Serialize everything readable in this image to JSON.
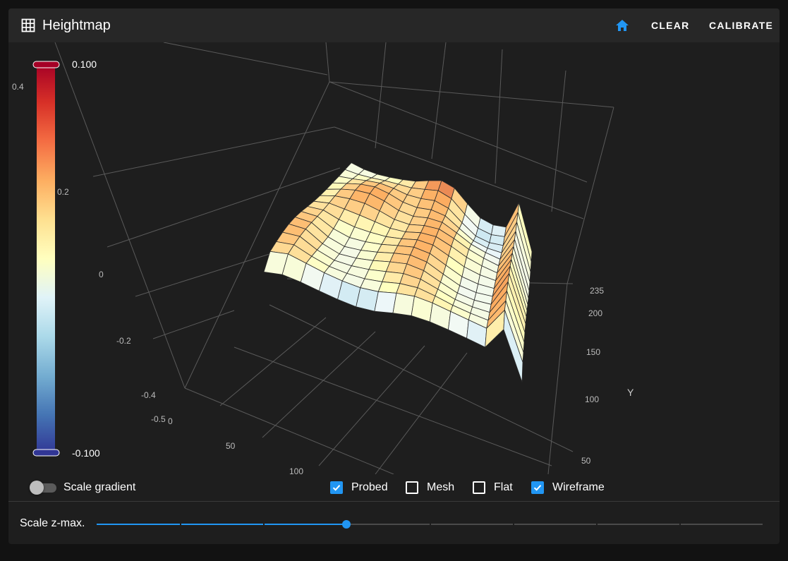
{
  "toolbar": {
    "title": "Heightmap",
    "title_icon": "grid-icon",
    "home_icon": "home-icon",
    "clear_label": "CLEAR",
    "calibrate_label": "CALIBRATE",
    "accent_color": "#2196f3"
  },
  "colorbar": {
    "max_label": "0.100",
    "min_label": "-0.100",
    "tick_labels": [
      "0.4",
      "0.2"
    ],
    "colors": [
      "#a50026",
      "#d73027",
      "#f46d43",
      "#fdae61",
      "#fee090",
      "#ffffbf",
      "#e0f3f8",
      "#abd9e9",
      "#74add1",
      "#4575b4",
      "#313695"
    ]
  },
  "plot": {
    "z_tick_labels": [
      "0",
      "-0.2",
      "-0.4",
      "-0.5"
    ],
    "x_tick_labels": [
      "0",
      "50",
      "100"
    ],
    "y_tick_labels": [
      "235",
      "200",
      "150",
      "100",
      "50"
    ],
    "y_axis_label": "Y"
  },
  "controls": {
    "scale_gradient_label": "Scale gradient",
    "scale_gradient_on": false,
    "checkboxes": [
      {
        "label": "Probed",
        "checked": true
      },
      {
        "label": "Mesh",
        "checked": false
      },
      {
        "label": "Flat",
        "checked": false
      },
      {
        "label": "Wireframe",
        "checked": true
      }
    ]
  },
  "slider": {
    "label": "Scale z-max.",
    "value_fraction": 0.375
  }
}
